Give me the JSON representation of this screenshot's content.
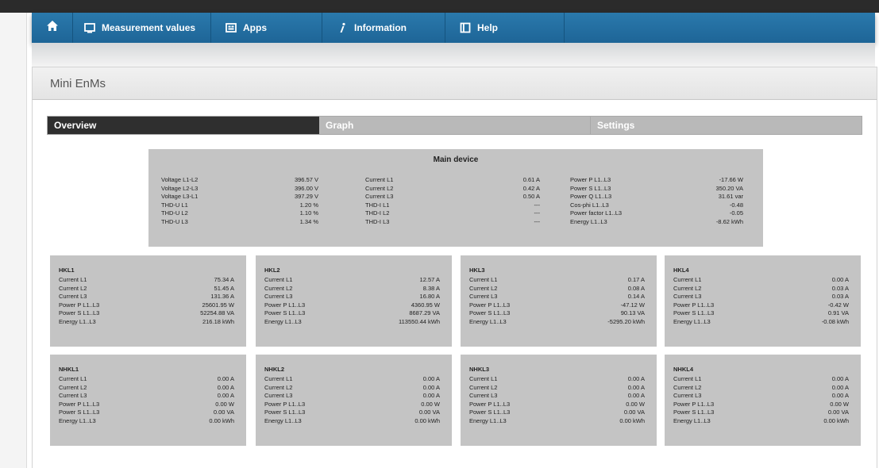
{
  "nav": {
    "home_icon": "home-icon",
    "items": [
      {
        "label": "Measurement values",
        "icon": "monitor-icon"
      },
      {
        "label": "Apps",
        "icon": "apps-icon"
      },
      {
        "label": "Information",
        "icon": "info-icon"
      },
      {
        "label": "Help",
        "icon": "help-book-icon"
      }
    ]
  },
  "page": {
    "title": "Mini EnMs"
  },
  "tabs": [
    {
      "label": "Overview",
      "active": true
    },
    {
      "label": "Graph",
      "active": false
    },
    {
      "label": "Settings",
      "active": false
    }
  ],
  "main_device": {
    "title": "Main device",
    "col1": [
      {
        "label": "Voltage L1-L2",
        "value": "396.57 V"
      },
      {
        "label": "Voltage L2-L3",
        "value": "396.00 V"
      },
      {
        "label": "Voltage L3-L1",
        "value": "397.29 V"
      },
      {
        "label": "THD-U L1",
        "value": "1.20 %"
      },
      {
        "label": "THD-U L2",
        "value": "1.10 %"
      },
      {
        "label": "THD-U L3",
        "value": "1.34 %"
      }
    ],
    "col2": [
      {
        "label": "Current L1",
        "value": "0.61 A"
      },
      {
        "label": "Current L2",
        "value": "0.42 A"
      },
      {
        "label": "Current L3",
        "value": "0.50 A"
      },
      {
        "label": "THD-I L1",
        "value": "---"
      },
      {
        "label": "THD-I L2",
        "value": "---"
      },
      {
        "label": "THD-I L3",
        "value": "---"
      }
    ],
    "col3": [
      {
        "label": "Power P L1..L3",
        "value": "-17.66 W"
      },
      {
        "label": "Power S L1..L3",
        "value": "350.20 VA"
      },
      {
        "label": "Power Q L1..L3",
        "value": "31.61 var"
      },
      {
        "label": "Cos-phi L1..L3",
        "value": "-0.48"
      },
      {
        "label": "Power factor L1..L3",
        "value": "-0.05"
      },
      {
        "label": "Energy L1..L3",
        "value": "-8.62 kWh"
      }
    ]
  },
  "cards": [
    {
      "title": "HKL1",
      "rows": [
        {
          "label": "Current L1",
          "value": "75.34 A"
        },
        {
          "label": "Current L2",
          "value": "51.45 A"
        },
        {
          "label": "Current L3",
          "value": "131.36 A"
        },
        {
          "label": "Power P L1..L3",
          "value": "25601.95 W"
        },
        {
          "label": "Power S L1..L3",
          "value": "52254.88 VA"
        },
        {
          "label": "Energy L1..L3",
          "value": "216.18 kWh"
        }
      ]
    },
    {
      "title": "HKL2",
      "rows": [
        {
          "label": "Current L1",
          "value": "12.57 A"
        },
        {
          "label": "Current L2",
          "value": "8.38 A"
        },
        {
          "label": "Current L3",
          "value": "16.80 A"
        },
        {
          "label": "Power P L1..L3",
          "value": "4360.95 W"
        },
        {
          "label": "Power S L1..L3",
          "value": "8687.29 VA"
        },
        {
          "label": "Energy L1..L3",
          "value": "113550.44 kWh"
        }
      ]
    },
    {
      "title": "HKL3",
      "rows": [
        {
          "label": "Current L1",
          "value": "0.17 A"
        },
        {
          "label": "Current L2",
          "value": "0.08 A"
        },
        {
          "label": "Current L3",
          "value": "0.14 A"
        },
        {
          "label": "Power P L1..L3",
          "value": "-47.12 W"
        },
        {
          "label": "Power S L1..L3",
          "value": "90.13 VA"
        },
        {
          "label": "Energy L1..L3",
          "value": "-5295.20 kWh"
        }
      ]
    },
    {
      "title": "HKL4",
      "rows": [
        {
          "label": "Current L1",
          "value": "0.00 A"
        },
        {
          "label": "Current L2",
          "value": "0.03 A"
        },
        {
          "label": "Current L3",
          "value": "0.03 A"
        },
        {
          "label": "Power P L1..L3",
          "value": "-0.42 W"
        },
        {
          "label": "Power S L1..L3",
          "value": "0.91 VA"
        },
        {
          "label": "Energy L1..L3",
          "value": "-0.08 kWh"
        }
      ]
    },
    {
      "title": "NHKL1",
      "rows": [
        {
          "label": "Current L1",
          "value": "0.00 A"
        },
        {
          "label": "Current L2",
          "value": "0.00 A"
        },
        {
          "label": "Current L3",
          "value": "0.00 A"
        },
        {
          "label": "Power P L1..L3",
          "value": "0.00 W"
        },
        {
          "label": "Power S L1..L3",
          "value": "0.00 VA"
        },
        {
          "label": "Energy L1..L3",
          "value": "0.00 kWh"
        }
      ]
    },
    {
      "title": "NHKL2",
      "rows": [
        {
          "label": "Current L1",
          "value": "0.00 A"
        },
        {
          "label": "Current L2",
          "value": "0.00 A"
        },
        {
          "label": "Current L3",
          "value": "0.00 A"
        },
        {
          "label": "Power P L1..L3",
          "value": "0.00 W"
        },
        {
          "label": "Power S L1..L3",
          "value": "0.00 VA"
        },
        {
          "label": "Energy L1..L3",
          "value": "0.00 kWh"
        }
      ]
    },
    {
      "title": "NHKL3",
      "rows": [
        {
          "label": "Current L1",
          "value": "0.00 A"
        },
        {
          "label": "Current L2",
          "value": "0.00 A"
        },
        {
          "label": "Current L3",
          "value": "0.00 A"
        },
        {
          "label": "Power P L1..L3",
          "value": "0.00 W"
        },
        {
          "label": "Power S L1..L3",
          "value": "0.00 VA"
        },
        {
          "label": "Energy L1..L3",
          "value": "0.00 kWh"
        }
      ]
    },
    {
      "title": "NHKL4",
      "rows": [
        {
          "label": "Current L1",
          "value": "0.00 A"
        },
        {
          "label": "Current L2",
          "value": "0.00 A"
        },
        {
          "label": "Current L3",
          "value": "0.00 A"
        },
        {
          "label": "Power P L1..L3",
          "value": "0.00 W"
        },
        {
          "label": "Power S L1..L3",
          "value": "0.00 VA"
        },
        {
          "label": "Energy L1..L3",
          "value": "0.00 kWh"
        }
      ]
    }
  ]
}
